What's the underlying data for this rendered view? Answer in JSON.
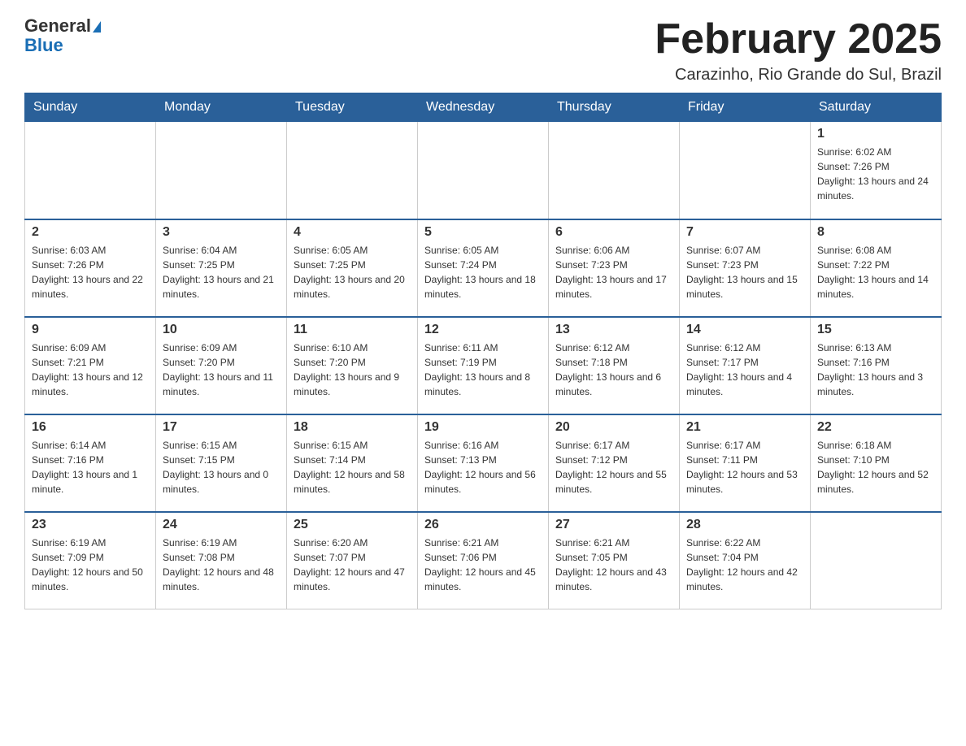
{
  "header": {
    "logo_general": "General",
    "logo_blue": "Blue",
    "month_title": "February 2025",
    "location": "Carazinho, Rio Grande do Sul, Brazil"
  },
  "weekdays": [
    "Sunday",
    "Monday",
    "Tuesday",
    "Wednesday",
    "Thursday",
    "Friday",
    "Saturday"
  ],
  "weeks": [
    [
      {
        "day": "",
        "info": ""
      },
      {
        "day": "",
        "info": ""
      },
      {
        "day": "",
        "info": ""
      },
      {
        "day": "",
        "info": ""
      },
      {
        "day": "",
        "info": ""
      },
      {
        "day": "",
        "info": ""
      },
      {
        "day": "1",
        "info": "Sunrise: 6:02 AM\nSunset: 7:26 PM\nDaylight: 13 hours and 24 minutes."
      }
    ],
    [
      {
        "day": "2",
        "info": "Sunrise: 6:03 AM\nSunset: 7:26 PM\nDaylight: 13 hours and 22 minutes."
      },
      {
        "day": "3",
        "info": "Sunrise: 6:04 AM\nSunset: 7:25 PM\nDaylight: 13 hours and 21 minutes."
      },
      {
        "day": "4",
        "info": "Sunrise: 6:05 AM\nSunset: 7:25 PM\nDaylight: 13 hours and 20 minutes."
      },
      {
        "day": "5",
        "info": "Sunrise: 6:05 AM\nSunset: 7:24 PM\nDaylight: 13 hours and 18 minutes."
      },
      {
        "day": "6",
        "info": "Sunrise: 6:06 AM\nSunset: 7:23 PM\nDaylight: 13 hours and 17 minutes."
      },
      {
        "day": "7",
        "info": "Sunrise: 6:07 AM\nSunset: 7:23 PM\nDaylight: 13 hours and 15 minutes."
      },
      {
        "day": "8",
        "info": "Sunrise: 6:08 AM\nSunset: 7:22 PM\nDaylight: 13 hours and 14 minutes."
      }
    ],
    [
      {
        "day": "9",
        "info": "Sunrise: 6:09 AM\nSunset: 7:21 PM\nDaylight: 13 hours and 12 minutes."
      },
      {
        "day": "10",
        "info": "Sunrise: 6:09 AM\nSunset: 7:20 PM\nDaylight: 13 hours and 11 minutes."
      },
      {
        "day": "11",
        "info": "Sunrise: 6:10 AM\nSunset: 7:20 PM\nDaylight: 13 hours and 9 minutes."
      },
      {
        "day": "12",
        "info": "Sunrise: 6:11 AM\nSunset: 7:19 PM\nDaylight: 13 hours and 8 minutes."
      },
      {
        "day": "13",
        "info": "Sunrise: 6:12 AM\nSunset: 7:18 PM\nDaylight: 13 hours and 6 minutes."
      },
      {
        "day": "14",
        "info": "Sunrise: 6:12 AM\nSunset: 7:17 PM\nDaylight: 13 hours and 4 minutes."
      },
      {
        "day": "15",
        "info": "Sunrise: 6:13 AM\nSunset: 7:16 PM\nDaylight: 13 hours and 3 minutes."
      }
    ],
    [
      {
        "day": "16",
        "info": "Sunrise: 6:14 AM\nSunset: 7:16 PM\nDaylight: 13 hours and 1 minute."
      },
      {
        "day": "17",
        "info": "Sunrise: 6:15 AM\nSunset: 7:15 PM\nDaylight: 13 hours and 0 minutes."
      },
      {
        "day": "18",
        "info": "Sunrise: 6:15 AM\nSunset: 7:14 PM\nDaylight: 12 hours and 58 minutes."
      },
      {
        "day": "19",
        "info": "Sunrise: 6:16 AM\nSunset: 7:13 PM\nDaylight: 12 hours and 56 minutes."
      },
      {
        "day": "20",
        "info": "Sunrise: 6:17 AM\nSunset: 7:12 PM\nDaylight: 12 hours and 55 minutes."
      },
      {
        "day": "21",
        "info": "Sunrise: 6:17 AM\nSunset: 7:11 PM\nDaylight: 12 hours and 53 minutes."
      },
      {
        "day": "22",
        "info": "Sunrise: 6:18 AM\nSunset: 7:10 PM\nDaylight: 12 hours and 52 minutes."
      }
    ],
    [
      {
        "day": "23",
        "info": "Sunrise: 6:19 AM\nSunset: 7:09 PM\nDaylight: 12 hours and 50 minutes."
      },
      {
        "day": "24",
        "info": "Sunrise: 6:19 AM\nSunset: 7:08 PM\nDaylight: 12 hours and 48 minutes."
      },
      {
        "day": "25",
        "info": "Sunrise: 6:20 AM\nSunset: 7:07 PM\nDaylight: 12 hours and 47 minutes."
      },
      {
        "day": "26",
        "info": "Sunrise: 6:21 AM\nSunset: 7:06 PM\nDaylight: 12 hours and 45 minutes."
      },
      {
        "day": "27",
        "info": "Sunrise: 6:21 AM\nSunset: 7:05 PM\nDaylight: 12 hours and 43 minutes."
      },
      {
        "day": "28",
        "info": "Sunrise: 6:22 AM\nSunset: 7:04 PM\nDaylight: 12 hours and 42 minutes."
      },
      {
        "day": "",
        "info": ""
      }
    ]
  ]
}
